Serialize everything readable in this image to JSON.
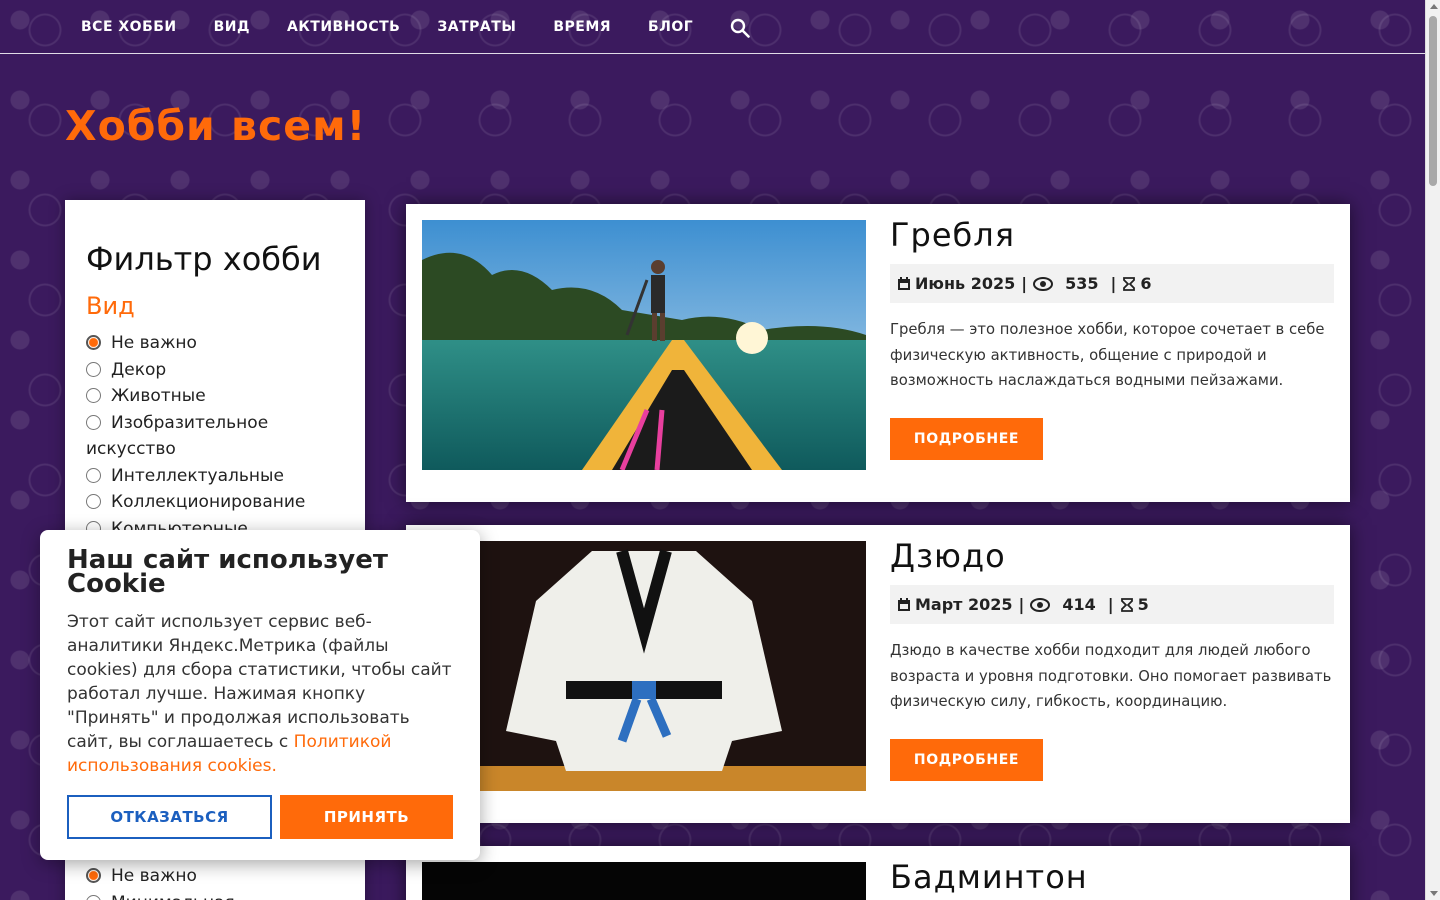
{
  "nav": {
    "items": [
      "ВСЕ ХОББИ",
      "ВИД",
      "АКТИВНОСТЬ",
      "ЗАТРАТЫ",
      "ВРЕМЯ",
      "БЛОГ"
    ],
    "search_icon": "search-icon"
  },
  "page": {
    "title": "Хобби всем!"
  },
  "filter": {
    "title": "Фильтр хобби",
    "group_kind": {
      "title": "Вид",
      "options": [
        "Не важно",
        "Декор",
        "Животные",
        "Изобразительное",
        "искусство",
        "Интеллектуальные",
        "Коллекционирование",
        "Компьютерные"
      ],
      "selected": "Не важно"
    },
    "group_second": {
      "options": [
        "Не важно",
        "Минимальная"
      ],
      "selected": "Не важно"
    }
  },
  "hobbies": [
    {
      "name": "Гребля",
      "date": "Июнь 2025",
      "views": "535",
      "duration": "6",
      "description": "Гребля — это полезное хобби, которое сочетает в себе физическую активность, общение с природой и возможность наслаждаться водными пейзажами.",
      "button": "ПОДРОБНЕЕ"
    },
    {
      "name": "Дзюдо",
      "date": "Март 2025",
      "views": "414",
      "duration": "5",
      "description": "Дзюдо в качестве хобби подходит для людей любого возраста и уровня подготовки. Оно помогает развивать физическую силу, гибкость, координацию.",
      "button": "ПОДРОБНЕЕ"
    },
    {
      "name": "Бадминтон"
    }
  ],
  "cookie": {
    "title": "Наш сайт использует Cookie",
    "text": "Этот сайт использует сервис веб-аналитики Яндекс.Метрика (файлы cookies) для сбора статистики, чтобы сайт работал лучше. Нажимая кнопку \"Принять\" и продолжая использовать сайт, вы соглашаетесь с ",
    "link": "Политикой использования cookies.",
    "decline": "ОТКАЗАТЬСЯ",
    "accept": "ПРИНЯТЬ"
  },
  "colors": {
    "accent": "#ff6a0a",
    "background": "#3b1a5e",
    "decline_blue": "#1b5fbf"
  }
}
